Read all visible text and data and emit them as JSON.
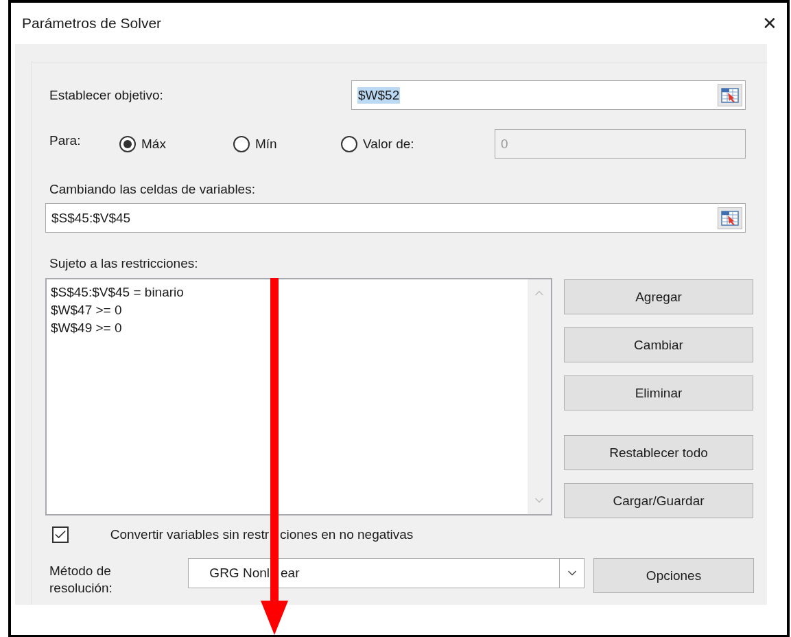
{
  "window": {
    "title": "Parámetros de Solver",
    "close": "✕"
  },
  "objective": {
    "label": "Establecer objetivo:",
    "value": "$W$52",
    "selected": true
  },
  "to": {
    "label": "Para:",
    "options": [
      {
        "label": "Máx",
        "selected": true
      },
      {
        "label": "Mín",
        "selected": false
      },
      {
        "label": "Valor de:",
        "selected": false
      }
    ],
    "value_field": {
      "value": "0",
      "disabled": true
    }
  },
  "variables": {
    "label": "Cambiando las celdas de variables:",
    "value": "$S$45:$V$45"
  },
  "constraints": {
    "label": "Sujeto a las restricciones:",
    "items": [
      "$S$45:$V$45 = binario",
      "$W$47 >= 0",
      "$W$49 >= 0"
    ]
  },
  "button_groups": [
    [
      "Agregar",
      "Cambiar",
      "Eliminar"
    ],
    [
      "Restablecer todo",
      "Cargar/Guardar"
    ]
  ],
  "nonnegative": {
    "label": "Convertir variables sin restr",
    "label_after_arrow": "ciones en no negativas",
    "checked": true
  },
  "method": {
    "label": "Método de resolución:",
    "value": "GRG Nonl",
    "value_after_arrow": "ear"
  },
  "options_button": "Opciones"
}
